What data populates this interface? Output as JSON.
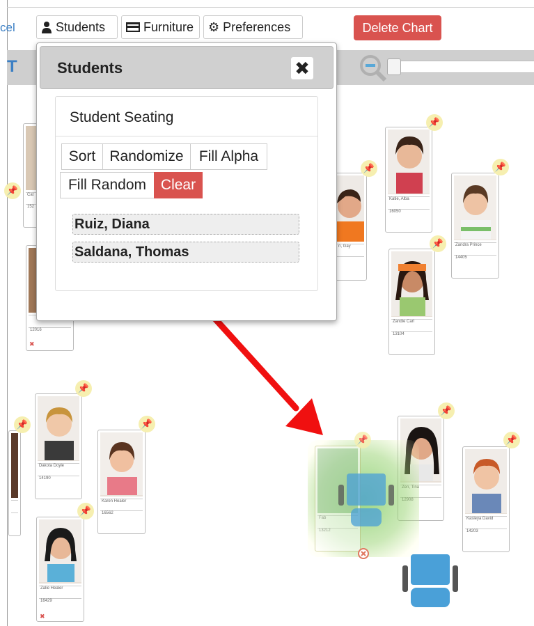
{
  "toolbar": {
    "cancel_link": "cel",
    "students_label": "Students",
    "furniture_label": "Furniture",
    "preferences_label": "Preferences",
    "delete_label": "Delete Chart"
  },
  "graybar": {
    "left_text": "T"
  },
  "modal": {
    "title": "Students",
    "panel_title": "Student Seating",
    "buttons": {
      "sort": "Sort",
      "randomize": "Randomize",
      "fill_alpha": "Fill Alpha",
      "fill_random": "Fill Random",
      "clear": "Clear"
    },
    "students": [
      "Ruiz, Diana",
      "Saldana, Thomas"
    ]
  },
  "cards": [
    {
      "name": "Cat",
      "id": "152"
    },
    {
      "name": "",
      "id": ""
    },
    {
      "name": "",
      "id": "12016"
    },
    {
      "name": "Katie, Alba",
      "id": "16050"
    },
    {
      "name": "Zandra Prince",
      "id": "14405"
    },
    {
      "name": "n, Gay",
      "id": ""
    },
    {
      "name": "Zandie Carl",
      "id": "13104"
    },
    {
      "name": "Dakota Doyle",
      "id": "14190"
    },
    {
      "name": "Karen Healer",
      "id": "16562"
    },
    {
      "name": "Zalie Healer",
      "id": "16429"
    },
    {
      "name": "Zen, Tina",
      "id": "12908"
    },
    {
      "name": "Kasleya David",
      "id": "14203"
    },
    {
      "name": "Fab",
      "id": "13212"
    }
  ]
}
